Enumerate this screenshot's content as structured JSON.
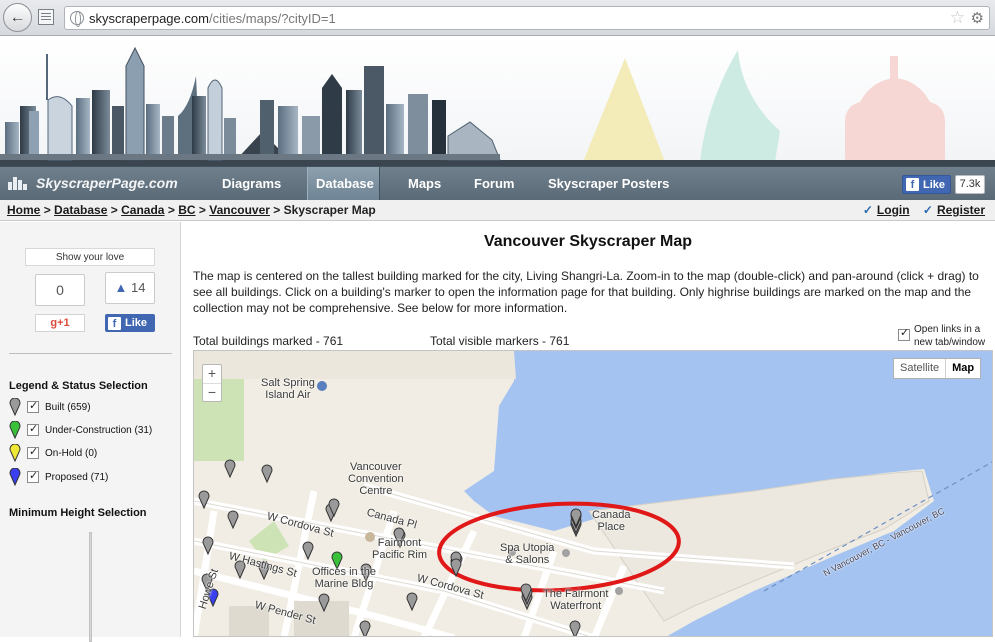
{
  "browser": {
    "url_domain": "skyscraperpage.com",
    "url_path": "/cities/maps/?cityID=1"
  },
  "nav": {
    "logo": "SkyscraperPage.com",
    "items": [
      {
        "label": "Diagrams",
        "active": false
      },
      {
        "label": "Database",
        "active": true
      },
      {
        "label": "Maps",
        "active": false
      },
      {
        "label": "Forum",
        "active": false
      },
      {
        "label": "Skyscraper Posters",
        "active": false
      }
    ],
    "fb_like": "Like",
    "fb_count": "7.3k"
  },
  "breadcrumb": {
    "items": [
      "Home",
      "Database",
      "Canada",
      "BC",
      "Vancouver"
    ],
    "separator": ">",
    "current": "Skyscraper Map",
    "login": "Login",
    "register": "Register"
  },
  "sidebar": {
    "show_love": "Show your love",
    "gplus_count": "0",
    "gplus_label": "+1",
    "fb_count": "14",
    "fb_like": "Like",
    "legend_heading": "Legend & Status Selection",
    "legend": [
      {
        "label": "Built (659)",
        "color": "#9a9a9a"
      },
      {
        "label": "Under-Construction (31)",
        "color": "#39c13a"
      },
      {
        "label": "On-Hold (0)",
        "color": "#efe735"
      },
      {
        "label": "Proposed (71)",
        "color": "#3a3ff0"
      }
    ],
    "height_heading": "Minimum Height Selection"
  },
  "content": {
    "title": "Vancouver Skyscraper Map",
    "intro": "The map is centered on the tallest building marked for the city, Living Shangri-La. Zoom-in to the map (double-click) and pan-around (click + drag) to see all buildings. Click on a building's marker to open the information page for that building. Only highrise buildings are marked on the map and the collection may not be comprehensive. See below for more information.",
    "total_marked": "Total buildings marked - 761",
    "total_visible": "Total visible markers - 761",
    "open_links": "Open links in a new tab/window"
  },
  "map": {
    "zoom_in": "+",
    "zoom_out": "−",
    "type_satellite": "Satellite",
    "type_map": "Map",
    "labels": {
      "salt_spring": "Salt Spring\nIsland Air",
      "convention": "Vancouver\nConvention\nCentre",
      "canada_place": "Canada\nPlace",
      "fairmont_pacific": "Fairmont\nPacific Rim",
      "spa": "Spa Utopia\n& Salons",
      "offices": "Offices in the\nMarine Bldg",
      "fairmont_wf": "The Fairmont\nWaterfront",
      "w_cordova_1": "W Cordova St",
      "canada_pl_st": "Canada Pl",
      "w_hastings": "W Hastings St",
      "w_cordova_2": "W Cordova St",
      "w_pender": "W Pender St",
      "howe": "Howe St",
      "route": "N Vancouver, BC - Vancouver, BC"
    }
  }
}
